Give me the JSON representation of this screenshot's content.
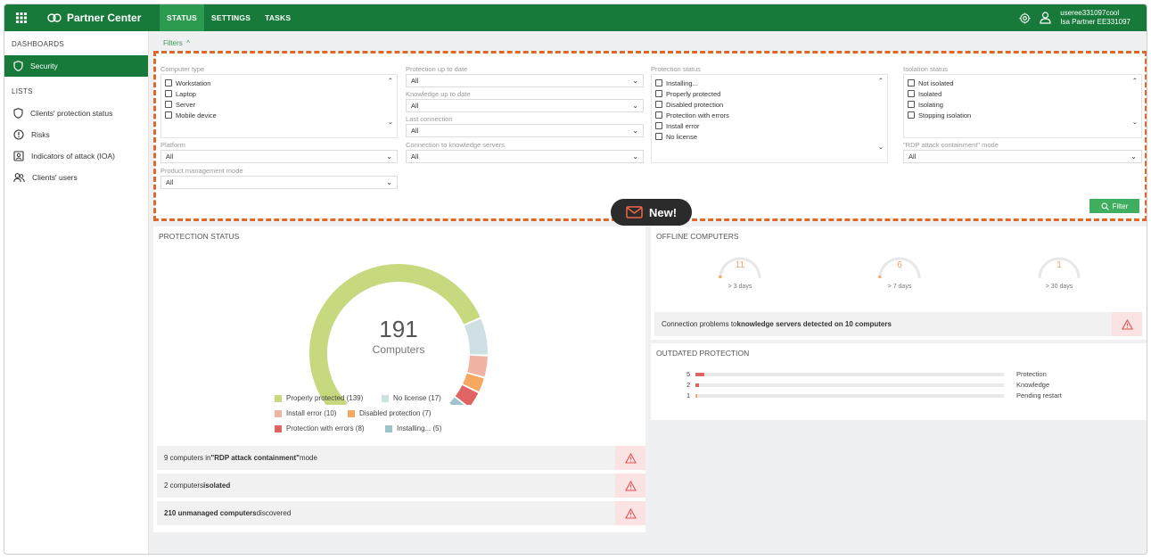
{
  "topbar": {
    "app_name": "Partner Center",
    "tabs": [
      "STATUS",
      "SETTINGS",
      "TASKS"
    ],
    "user_name": "useree331097cool",
    "user_org": "Isa Partner EE331097",
    "colors": {
      "bar": "#187a3a",
      "active_tab": "#2c9b50"
    }
  },
  "sidebar": {
    "dashboards_title": "DASHBOARDS",
    "dashboards": [
      {
        "label": "Security",
        "icon": "shield-icon"
      }
    ],
    "lists_title": "LISTS",
    "lists": [
      {
        "label": "Clients' protection status",
        "icon": "shield-icon"
      },
      {
        "label": "Risks",
        "icon": "warning-circle-icon"
      },
      {
        "label": "Indicators of attack (IOA)",
        "icon": "id-card-icon"
      },
      {
        "label": "Clients' users",
        "icon": "users-icon"
      }
    ]
  },
  "filters": {
    "toggle_label": "Filters",
    "computer_type": {
      "label": "Computer type",
      "options": [
        "Workstation",
        "Laptop",
        "Server",
        "Mobile device"
      ]
    },
    "platform": {
      "label": "Platform",
      "value": "All"
    },
    "product_mgmt": {
      "label": "Product management mode",
      "value": "All"
    },
    "protection_up_to_date": {
      "label": "Protection up to date",
      "value": "All"
    },
    "knowledge_up_to_date": {
      "label": "Knowledge up to date",
      "value": "All"
    },
    "last_connection": {
      "label": "Last connection",
      "value": "All"
    },
    "connection_knowledge": {
      "label": "Connection to knowledge servers",
      "value": "All"
    },
    "protection_status": {
      "label": "Protection status",
      "options": [
        "Installing...",
        "Properly protected",
        "Disabled protection",
        "Protection with errors",
        "Install error",
        "No license"
      ]
    },
    "isolation_status": {
      "label": "Isolation status",
      "options": [
        "Not isolated",
        "Isolated",
        "Isolating",
        "Stopping isolation"
      ]
    },
    "rdp_mode": {
      "label": "\"RDP attack containment\" mode",
      "value": "All"
    },
    "filter_button": "Filter"
  },
  "new_badge": "New!",
  "protection_status": {
    "title": "PROTECTION STATUS",
    "total": "191",
    "total_label": "Computers",
    "legend": [
      {
        "label": "Properly protected (139)",
        "color": "#c6d97e"
      },
      {
        "label": "No license (17)",
        "color": "#cfe0e3"
      },
      {
        "label": "Install error (10)",
        "color": "#f1b4a4"
      },
      {
        "label": "Disabled protection (7)",
        "color": "#f6a860"
      },
      {
        "label": "Protection with errors (8)",
        "color": "#e06464"
      },
      {
        "label": "Installing... (5)",
        "color": "#9fc4cc"
      }
    ],
    "alerts": [
      {
        "pre": "9 computers in ",
        "bold": "\"RDP attack containment\"",
        "post": " mode"
      },
      {
        "pre": "2 computers ",
        "bold": "isolated",
        "post": ""
      },
      {
        "pre": "",
        "bold": "210 unmanaged computers",
        "post": " discovered"
      }
    ]
  },
  "chart_data": {
    "type": "pie",
    "categories": [
      "Properly protected",
      "No license",
      "Install error",
      "Disabled protection",
      "Protection with errors",
      "Installing..."
    ],
    "values": [
      139,
      17,
      10,
      7,
      8,
      5
    ]
  },
  "offline": {
    "title": "OFFLINE COMPUTERS",
    "gauges": [
      {
        "value": "11",
        "label": "> 3 days"
      },
      {
        "value": "6",
        "label": "> 7 days"
      },
      {
        "value": "1",
        "label": "> 30 days"
      }
    ],
    "conn_pre": "Connection problems to ",
    "conn_bold": "knowledge servers detected on 10 computers"
  },
  "outdated": {
    "title": "OUTDATED PROTECTION",
    "rows": [
      {
        "count": "5",
        "label": "Protection",
        "fraction": 0.03,
        "color": "#e06464"
      },
      {
        "count": "2",
        "label": "Knowledge",
        "fraction": 0.013,
        "color": "#e06464"
      },
      {
        "count": "1",
        "label": "Pending restart",
        "fraction": 0.006,
        "color": "#f6a860"
      }
    ]
  }
}
